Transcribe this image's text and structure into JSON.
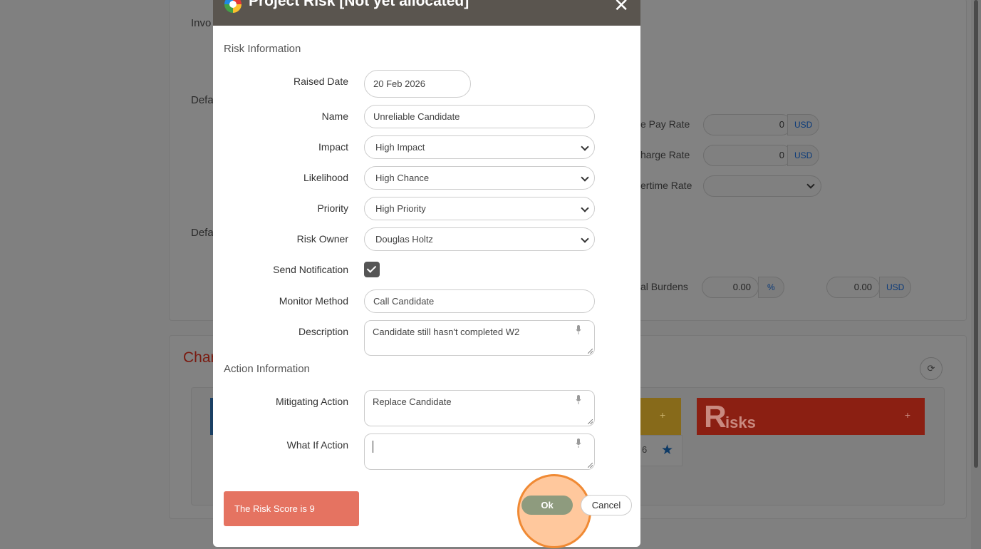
{
  "background": {
    "labels": {
      "invo": "Invo",
      "defa1": "Defa",
      "defa2": "Defa",
      "pay_rate": "e Pay Rate",
      "charge_rate": "harge Rate",
      "overtime_rate": "ertime Rate",
      "burdens": "al Burdens",
      "char": "Char"
    },
    "pay_rate_value": "0",
    "charge_rate_value": "0",
    "burden_pct_value": "0.00",
    "burden_usd_value": "0.00",
    "unit_usd": "USD",
    "unit_pct": "%",
    "card_date_fragment": "6",
    "risks_card_title_big": "R",
    "risks_card_title_rest": "isks",
    "card_plus": "+"
  },
  "modal": {
    "title": "Project Risk [Not yet allocated]",
    "close_symbol": "✕",
    "risk_section": "Risk Information",
    "action_section": "Action Information",
    "fields": {
      "raised_date": {
        "label": "Raised Date",
        "value": "20 Feb 2026"
      },
      "name": {
        "label": "Name",
        "value": "Unreliable Candidate"
      },
      "impact": {
        "label": "Impact",
        "value": "High Impact"
      },
      "likelihood": {
        "label": "Likelihood",
        "value": "High Chance"
      },
      "priority": {
        "label": "Priority",
        "value": "High Priority"
      },
      "risk_owner": {
        "label": "Risk Owner",
        "value": "Douglas Holtz"
      },
      "send_notification": {
        "label": "Send Notification",
        "checked": true
      },
      "monitor_method": {
        "label": "Monitor Method",
        "value": "Call Candidate"
      },
      "description": {
        "label": "Description",
        "value": "Candidate still hasn't completed W2"
      },
      "mitigating_action": {
        "label": "Mitigating Action",
        "value": "Replace Candidate"
      },
      "what_if_action": {
        "label": "What If Action",
        "value": ""
      }
    },
    "risk_score_text": "The Risk Score is 9",
    "ok_label": "Ok",
    "cancel_label": "Cancel"
  },
  "colors": {
    "header": "#5a554f",
    "score_box": "#e57361",
    "ok_button": "#8e9b7e",
    "highlight_ring": "#f08a34",
    "risks_card": "#8b1f12",
    "yellow_card": "#876a1a"
  }
}
